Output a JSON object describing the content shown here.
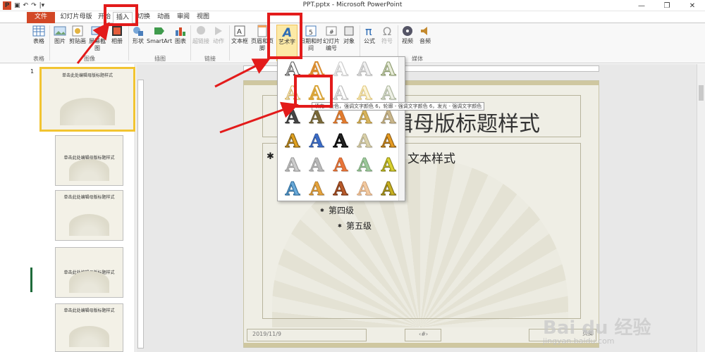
{
  "window": {
    "title": "PPT.pptx - Microsoft PowerPoint",
    "app_icon": "P",
    "qat_dropdown": "|▾",
    "minimize": "—",
    "restore": "❐",
    "close": "✕"
  },
  "tabs": [
    "文件",
    "幻灯片母版",
    "开始",
    "插入",
    "切换",
    "动画",
    "审阅",
    "视图"
  ],
  "ribbon": {
    "buttons": [
      "表格",
      "图片",
      "剪贴画",
      "屏幕截图",
      "相册",
      "形状",
      "SmartArt",
      "图表",
      "超链接",
      "动作",
      "文本框",
      "页眉和页脚",
      "艺术字",
      "日期和时间",
      "幻灯片编号",
      "对象",
      "公式",
      "符号",
      "视频",
      "音频"
    ],
    "groups": [
      "表格",
      "图像",
      "插图",
      "链接",
      "媒体"
    ]
  },
  "wordart": {
    "glyph": "A",
    "tooltip": "填充 - 金色，强调文字颜色 6，轮廓 - 强调文字颜色 6，发光 - 强调文字颜色 6"
  },
  "thumbnails": {
    "index": "1",
    "titles": [
      "单击此处编辑母版标题样式",
      "单击此处编辑母版标题样式",
      "单击此处编辑母版标题样式",
      "单击此处编辑母版标题样式",
      "单击此处编辑母版标题样式"
    ]
  },
  "slide": {
    "title": "辑母版标题样式",
    "bullet1": "文本样式",
    "level4": "第四级",
    "level5": "第五级",
    "date": "2019/11/9",
    "page_placeholder": "页脚",
    "slide_num": "‹#›"
  },
  "watermark": {
    "logo": "Bai du 经验",
    "url": "jingyan.baidu.com"
  },
  "colors": {
    "file_tab": "#d24726",
    "highlight": "#e31b1b",
    "selected_thumb": "#f2c431"
  }
}
